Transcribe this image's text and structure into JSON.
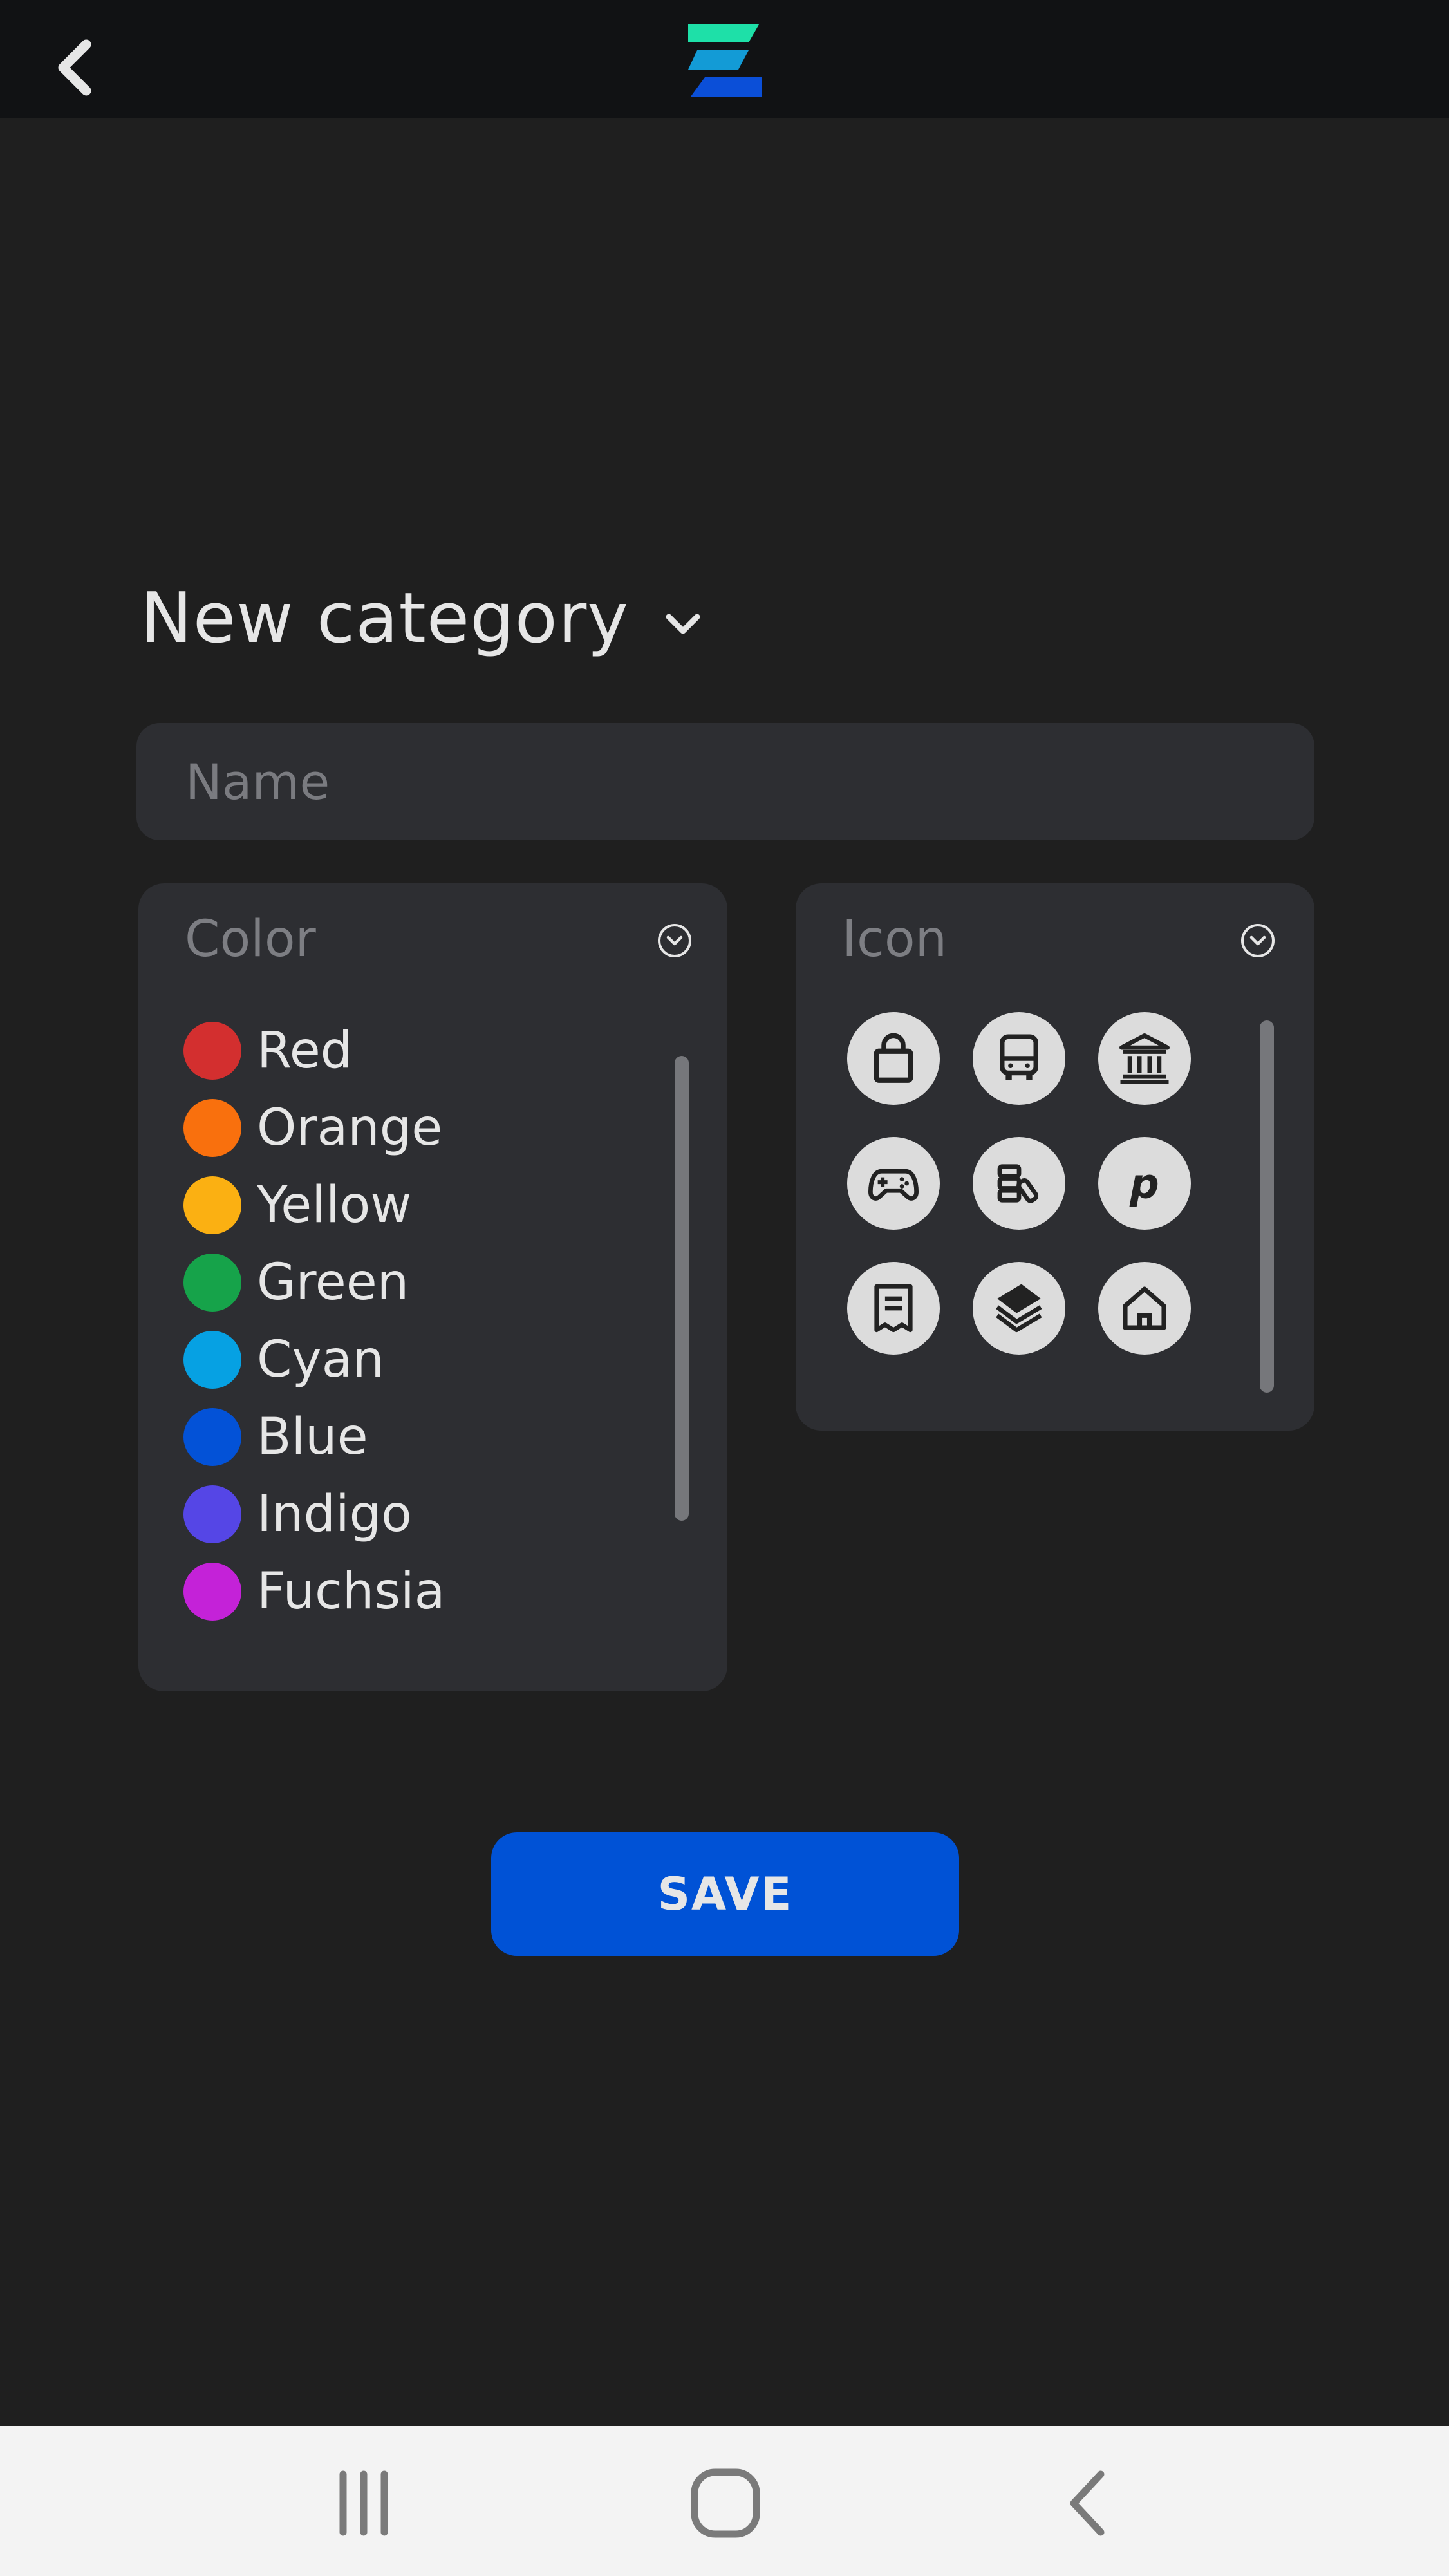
{
  "header": {
    "back_icon": "chevron-left-icon",
    "logo_icon": "app-logo-icon",
    "logo_colors": [
      "#1ee0a8",
      "#139bd6",
      "#0b4fd8"
    ]
  },
  "title": {
    "text": "New category",
    "dropdown_icon": "chevron-down-icon"
  },
  "name_field": {
    "placeholder": "Name",
    "value": ""
  },
  "color_panel": {
    "label": "Color",
    "toggle_icon": "chevron-down-circle-icon",
    "items": [
      {
        "label": "Red",
        "color": "#d32f2f"
      },
      {
        "label": "Orange",
        "color": "#f9700d"
      },
      {
        "label": "Yellow",
        "color": "#fbb012"
      },
      {
        "label": "Green",
        "color": "#16a34a"
      },
      {
        "label": "Cyan",
        "color": "#06a1e3"
      },
      {
        "label": "Blue",
        "color": "#0352d7"
      },
      {
        "label": "Indigo",
        "color": "#5546e6"
      },
      {
        "label": "Fuchsia",
        "color": "#c422d8"
      }
    ]
  },
  "icon_panel": {
    "label": "Icon",
    "toggle_icon": "chevron-down-circle-icon",
    "icons": [
      "shopping-bag-icon",
      "bus-icon",
      "bank-icon",
      "gamepad-icon",
      "coins-icon",
      "parking-icon",
      "receipt-icon",
      "layers-icon",
      "home-icon"
    ]
  },
  "save_button": {
    "label": "SAVE",
    "color": "#0052d6"
  },
  "system_nav": {
    "recents_icon": "recents-icon",
    "home_icon": "home-button-icon",
    "back_icon": "back-icon"
  }
}
